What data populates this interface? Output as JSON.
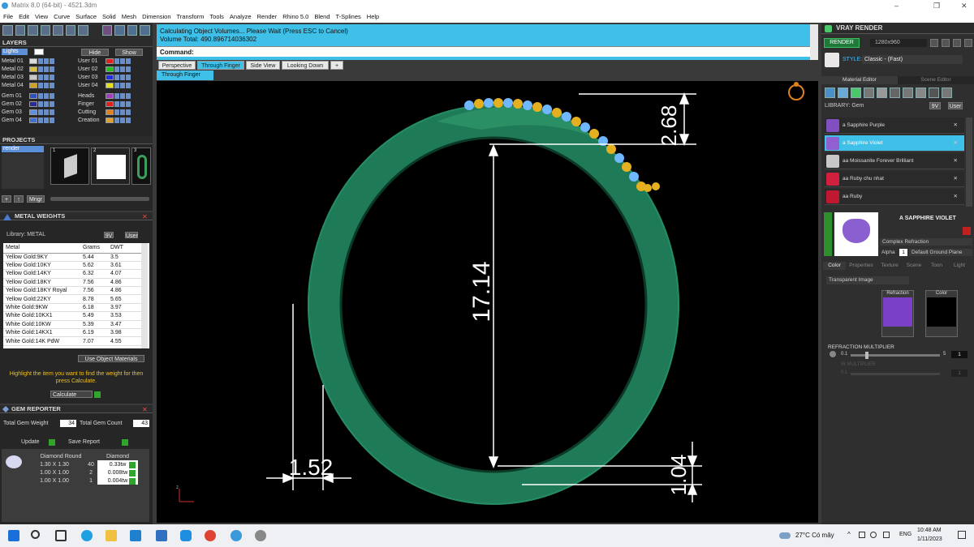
{
  "window": {
    "title": "Matrix 8.0 (64-bit) - 4521.3dm",
    "controls": [
      "–",
      "❐",
      "✕"
    ]
  },
  "menu": [
    "File",
    "Edit",
    "View",
    "Curve",
    "Surface",
    "Solid",
    "Mesh",
    "Dimension",
    "Transform",
    "Tools",
    "Analyze",
    "Render",
    "Rhino 5.0",
    "Blend",
    "T-Splines",
    "Help"
  ],
  "layers": {
    "title": "LAYERS",
    "top_left": "Lights",
    "hide_label": "Hide",
    "show_label": "Show",
    "left": [
      {
        "name": "Metal 01",
        "color": "#dcdcdc"
      },
      {
        "name": "Metal 02",
        "color": "#d8c040"
      },
      {
        "name": "Metal 03",
        "color": "#c8c8c8"
      },
      {
        "name": "Metal 04",
        "color": "#d0a020"
      },
      {
        "name": "Gem 01",
        "color": "#3050c0"
      },
      {
        "name": "Gem 02",
        "color": "#2a2a90"
      },
      {
        "name": "Gem 03",
        "color": "#6090e0"
      },
      {
        "name": "Gem 04",
        "color": "#4070d0"
      }
    ],
    "right": [
      {
        "name": "User 01",
        "color": "#e02020"
      },
      {
        "name": "User 02",
        "color": "#20c020"
      },
      {
        "name": "User 03",
        "color": "#2030e0"
      },
      {
        "name": "User 04",
        "color": "#e0e020"
      },
      {
        "name": "Heads",
        "color": "#a040c0"
      },
      {
        "name": "Finger",
        "color": "#e02020"
      },
      {
        "name": "Cutting",
        "color": "#e08020"
      },
      {
        "name": "Creation",
        "color": "#e0a030"
      }
    ]
  },
  "projects": {
    "title": "PROJECTS",
    "item": "render",
    "thumbs": [
      "1",
      "2",
      "3"
    ],
    "manager": "Mngr"
  },
  "metal_weights": {
    "title": "METAL WEIGHTS",
    "library": "Library: METAL",
    "toggles": [
      "9V",
      "User"
    ],
    "headers": [
      "Metal",
      "Grams",
      "DWT"
    ],
    "rows": [
      [
        "Yellow Gold:9KY",
        "5.44",
        "3.5"
      ],
      [
        "Yellow Gold:10KY",
        "5.62",
        "3.61"
      ],
      [
        "Yellow Gold:14KY",
        "6.32",
        "4.07"
      ],
      [
        "Yellow Gold:18KY",
        "7.56",
        "4.86"
      ],
      [
        "Yellow Gold:18KY Royal",
        "7.56",
        "4.86"
      ],
      [
        "Yellow Gold:22KY",
        "8.78",
        "5.65"
      ],
      [
        "White Gold:9KW",
        "6.18",
        "3.97"
      ],
      [
        "White Gold:10KX1",
        "5.49",
        "3.53"
      ],
      [
        "White Gold:10KW",
        "5.39",
        "3.47"
      ],
      [
        "White Gold:14KX1",
        "6.19",
        "3.98"
      ],
      [
        "White Gold:14K PdW",
        "7.07",
        "4.55"
      ]
    ],
    "use_materials": "Use Object Materials",
    "hint": "Highlight the item you want to find the weight for then press Calculate.",
    "calculate": "Calculate"
  },
  "gem_reporter": {
    "title": "GEM REPORTER",
    "total_weight_label": "Total Gem Weight",
    "total_weight": "34",
    "total_count_label": "Total Gem Count",
    "total_count": "43",
    "update": "Update",
    "save_report": "Save Report",
    "col_shape": "Diamond Round",
    "col_material": "Diamond",
    "rows": [
      [
        "1.30 X 1.30",
        "40",
        "0.33tw"
      ],
      [
        "1.00 X 1.00",
        "2",
        "0.008tw"
      ],
      [
        "1.00 X 1.00",
        "1",
        "0.004tw"
      ]
    ]
  },
  "command": {
    "line1": "Calculating Object Volumes... Please Wait (Press ESC to Cancel)",
    "line2": "Volume Total: 490.896714036302",
    "prompt": "Command:"
  },
  "view_tabs": [
    "Perspective",
    "Through Finger",
    "Side View",
    "Looking Down",
    "+"
  ],
  "active_view": "Through Finger",
  "viewport": {
    "dims": {
      "top": "2.68",
      "inner": "17.14",
      "left": "1.52",
      "bottom": "1.04"
    },
    "axis_label": "z"
  },
  "vray": {
    "title": "VRAY RENDER",
    "render_label": "RENDER",
    "resolution": "1280x960",
    "style_label": "STYLE:",
    "style_value": "Classic - (Fast)",
    "tabs": [
      "Material Editor",
      "Scene Editor"
    ],
    "library": "LIBRARY: Gem",
    "lib_toggles": [
      "9V",
      "User"
    ],
    "materials": [
      {
        "name": "a Sapphire Purple",
        "color": "#8050c0",
        "selected": false
      },
      {
        "name": "a Sapphire Violet",
        "color": "#9060d0",
        "selected": true
      },
      {
        "name": "aa Moissanite Forever Brilliant",
        "color": "#c8c8c8",
        "selected": false
      },
      {
        "name": "aa Ruby chu nhat",
        "color": "#d02040",
        "selected": false
      },
      {
        "name": "aa Ruby",
        "color": "#c01830",
        "selected": false
      }
    ],
    "preview_name": "A SAPPHIRE VIOLET",
    "preview_type": "Complex Refraction",
    "alpha_label": "Alpha",
    "alpha_value": "1",
    "ground": "Default Ground Plane",
    "prop_tabs": [
      "Color",
      "Properties",
      "Texture",
      "Scene",
      "Toon",
      "Light"
    ],
    "transparent": "Transparent Image",
    "refraction_label": "Refraction",
    "color_label": "Color",
    "refraction_multiplier": "REFRACTION MULTIPLIER",
    "rm_min": "0.1",
    "rm_max": "5",
    "rm_value": "1",
    "ir_multiplier": "IR MULTIPLIER",
    "ir_min": "0.1",
    "ir_value": "1"
  },
  "taskbar": {
    "weather": "27°C Có mây",
    "lang": "ENG",
    "time": "10:48 AM",
    "date": "1/11/2023"
  }
}
